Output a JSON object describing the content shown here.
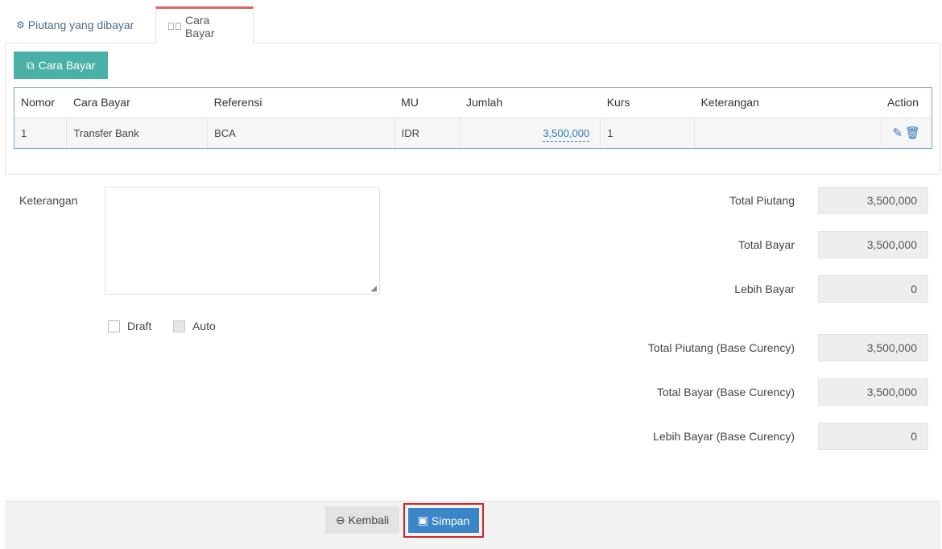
{
  "tabs": [
    {
      "label": "Piutang yang dibayar",
      "icon": "cogs-icon"
    },
    {
      "label": "Cara Bayar",
      "icon": "check-circle-icon"
    }
  ],
  "payment": {
    "add_button_label": "Cara Bayar",
    "columns": [
      "Nomor",
      "Cara Bayar",
      "Referensi",
      "MU",
      "Jumlah",
      "Kurs",
      "Keterangan",
      "Action"
    ],
    "rows": [
      {
        "nomor": "1",
        "cara_bayar": "Transfer Bank",
        "referensi": "BCA",
        "mu": "IDR",
        "jumlah": "3,500,000",
        "kurs": "1",
        "keterangan": ""
      }
    ]
  },
  "form": {
    "keterangan_label": "Keterangan",
    "keterangan_value": "",
    "draft_label": "Draft",
    "auto_label": "Auto"
  },
  "totals": {
    "total_piutang_label": "Total Piutang",
    "total_piutang": "3,500,000",
    "total_bayar_label": "Total Bayar",
    "total_bayar": "3,500,000",
    "lebih_bayar_label": "Lebih Bayar",
    "lebih_bayar": "0",
    "total_piutang_base_label": "Total Piutang (Base Curency)",
    "total_piutang_base": "3,500,000",
    "total_bayar_base_label": "Total Bayar (Base Curency)",
    "total_bayar_base": "3,500,000",
    "lebih_bayar_base_label": "Lebih Bayar (Base Curency)",
    "lebih_bayar_base": "0"
  },
  "footer": {
    "back_label": "Kembali",
    "save_label": "Simpan"
  },
  "colors": {
    "accent_teal": "#4ab1a6",
    "primary_blue": "#3b86c9",
    "active_tab_border": "#e0636a",
    "highlight_red": "#d0242b"
  }
}
